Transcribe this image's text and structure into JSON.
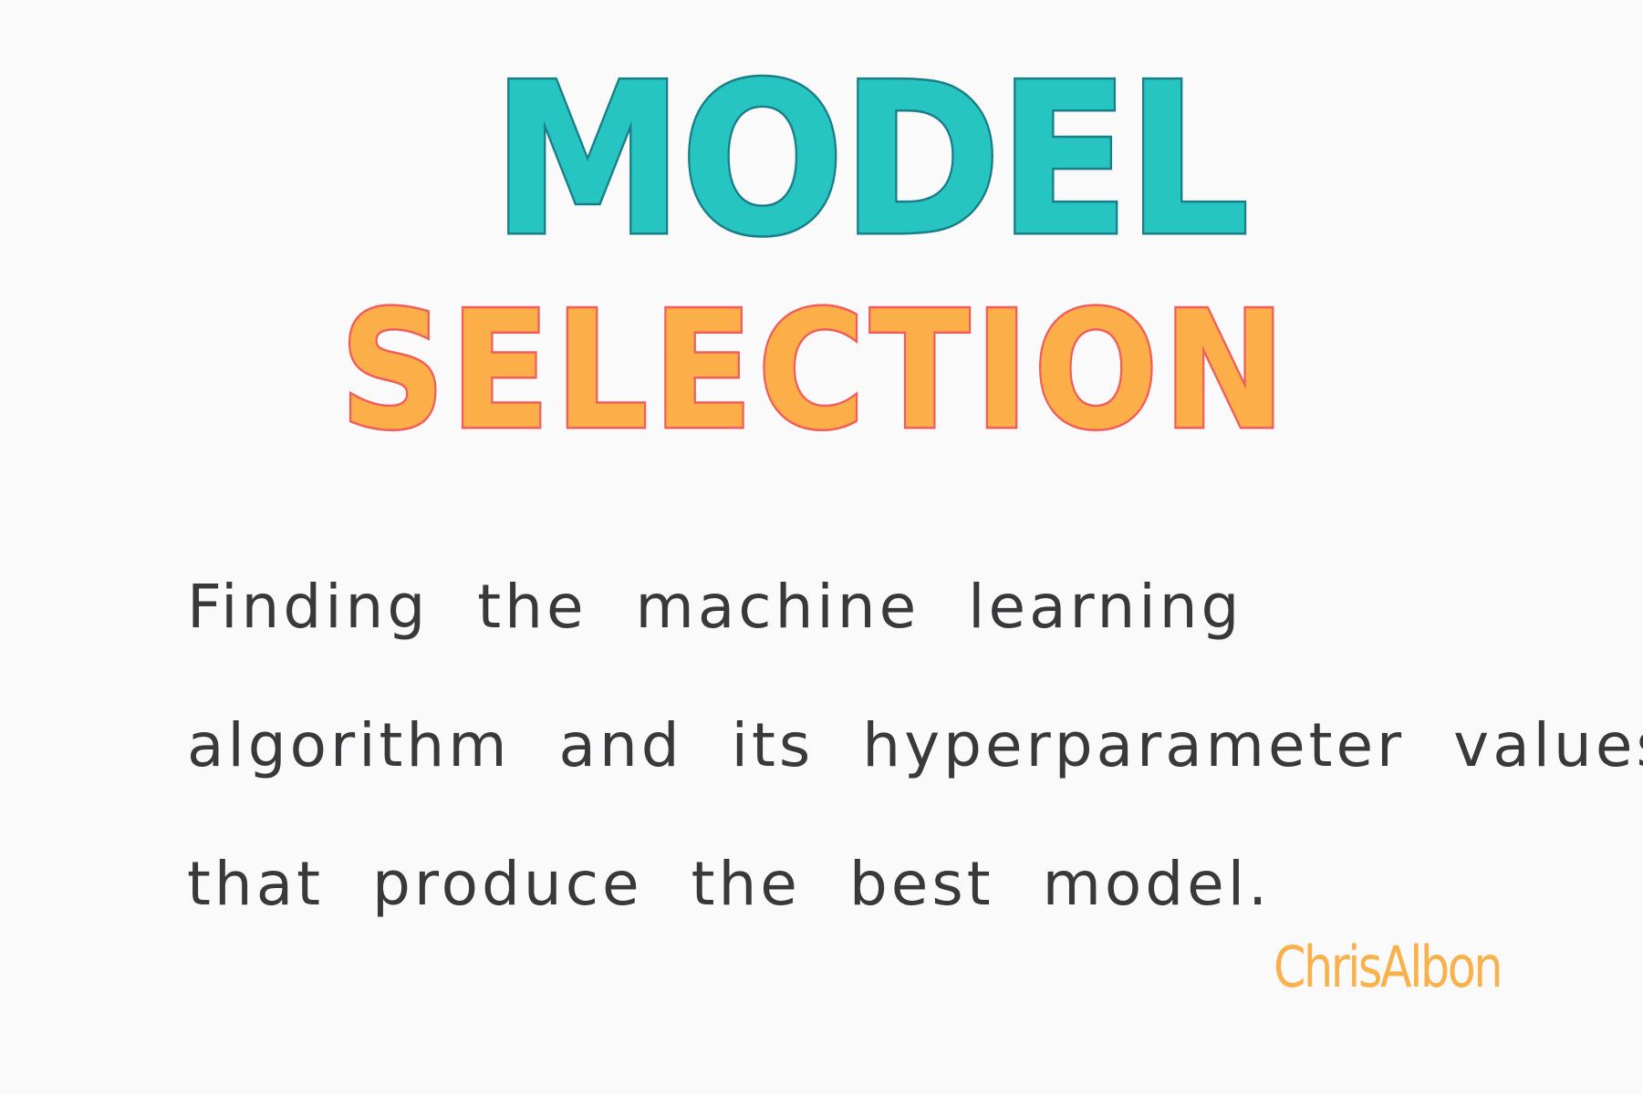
{
  "title": {
    "line_1": "Model",
    "line_2": "Selection"
  },
  "definition": {
    "lines": [
      "Finding the machine learning",
      "algorithm and its hyperparameter values",
      "that produce the best model."
    ]
  },
  "signature": "ChrisAlbon",
  "colors": {
    "background": "#fafafa",
    "title_line_1_fill": "#26c5c2",
    "title_line_1_outline": "#197e88",
    "title_line_2_fill": "#fcaf49",
    "title_line_2_outline": "#f25c5a",
    "body_text": "#3a383b",
    "signature": "#f9b14c"
  }
}
